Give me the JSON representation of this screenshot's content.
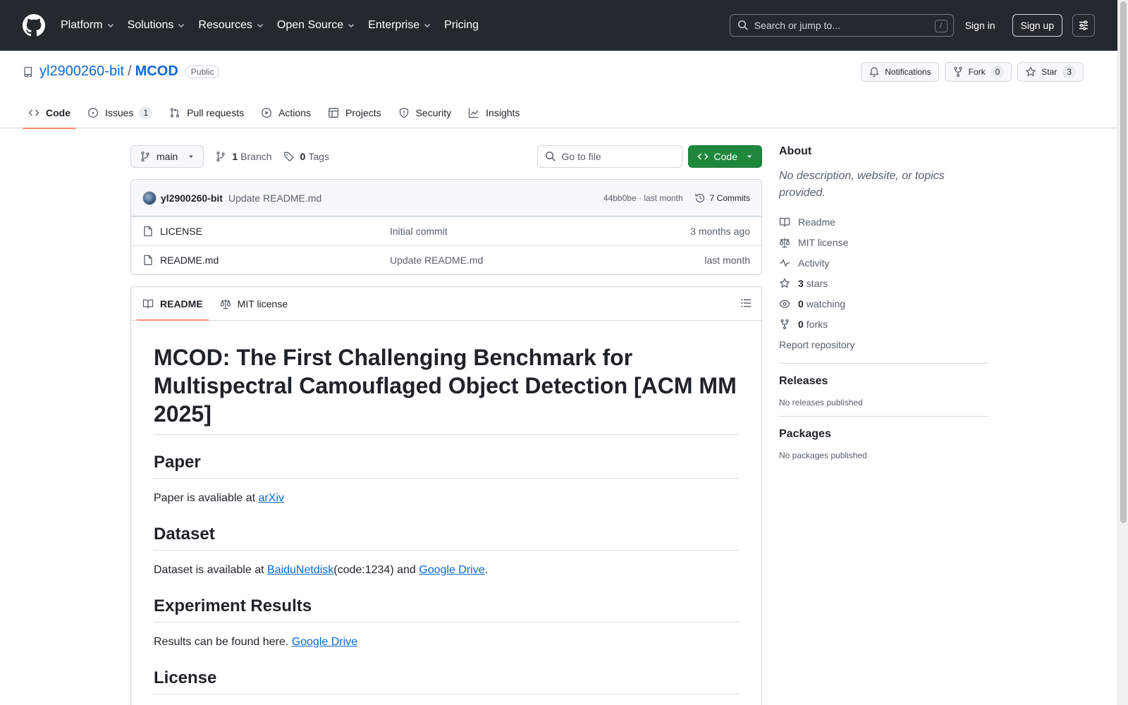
{
  "header": {
    "nav": [
      "Platform",
      "Solutions",
      "Resources",
      "Open Source",
      "Enterprise",
      "Pricing"
    ],
    "search_placeholder": "Search or jump to...",
    "search_shortcut": "/",
    "signin": "Sign in",
    "signup": "Sign up"
  },
  "repo": {
    "owner": "yl2900260-bit",
    "separator": "/",
    "name": "MCOD",
    "visibility": "Public",
    "notifications": "Notifications",
    "fork_label": "Fork",
    "fork_count": "0",
    "star_label": "Star",
    "star_count": "3",
    "tabs": [
      {
        "label": "Code",
        "count": ""
      },
      {
        "label": "Issues",
        "count": "1"
      },
      {
        "label": "Pull requests",
        "count": ""
      },
      {
        "label": "Actions",
        "count": ""
      },
      {
        "label": "Projects",
        "count": ""
      },
      {
        "label": "Security",
        "count": ""
      },
      {
        "label": "Insights",
        "count": ""
      }
    ]
  },
  "file_nav": {
    "branch": "main",
    "branch_count": "1",
    "branch_label": "Branch",
    "tag_count": "0",
    "tag_label": "Tags",
    "goto_placeholder": "Go to file",
    "code_button": "Code"
  },
  "commit": {
    "author": "yl2900260-bit",
    "message": "Update README.md",
    "hash_time": "44bb0be · last month",
    "commits": "7 Commits"
  },
  "files": [
    {
      "name": "LICENSE",
      "commit": "Initial commit",
      "time": "3 months ago"
    },
    {
      "name": "README.md",
      "commit": "Update README.md",
      "time": "last month"
    }
  ],
  "readme": {
    "tab_readme": "README",
    "tab_license": "MIT license",
    "title": "MCOD: The First Challenging Benchmark for Multispectral Camouflaged Object Detection [ACM MM 2025]",
    "sections": {
      "paper_h": "Paper",
      "paper_text": "Paper is avaliable at ",
      "paper_link": "arXiv",
      "dataset_h": "Dataset",
      "dataset_text": "Dataset is available at ",
      "dataset_link1": "BaiduNetdisk",
      "dataset_mid": "(code:1234) and ",
      "dataset_link2": "Google Drive",
      "dataset_end": ".",
      "results_h": "Experiment Results",
      "results_text": "Results can be found here. ",
      "results_link": "Google Drive",
      "license_h": "License"
    }
  },
  "sidebar": {
    "about_h": "About",
    "about_desc": "No description, website, or topics provided.",
    "readme": "Readme",
    "license": "MIT license",
    "activity": "Activity",
    "stars_n": "3",
    "stars": "stars",
    "watching_n": "0",
    "watching": "watching",
    "forks_n": "0",
    "forks": "forks",
    "report": "Report repository",
    "releases_h": "Releases",
    "releases_none": "No releases published",
    "packages_h": "Packages",
    "packages_none": "No packages published"
  }
}
